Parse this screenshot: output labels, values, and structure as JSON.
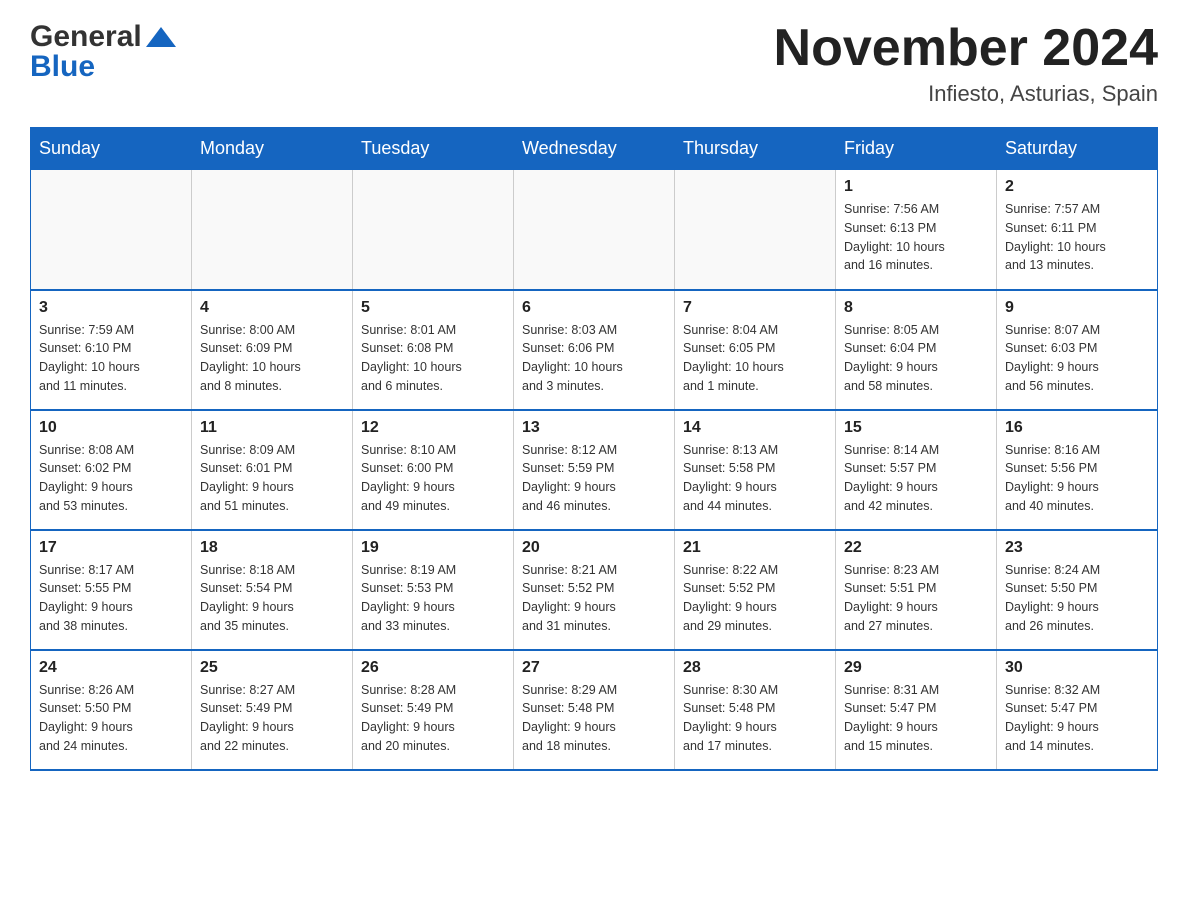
{
  "logo": {
    "line1": "General",
    "line2": "Blue"
  },
  "title": "November 2024",
  "location": "Infiesto, Asturias, Spain",
  "weekdays": [
    "Sunday",
    "Monday",
    "Tuesday",
    "Wednesday",
    "Thursday",
    "Friday",
    "Saturday"
  ],
  "weeks": [
    [
      {
        "day": "",
        "info": ""
      },
      {
        "day": "",
        "info": ""
      },
      {
        "day": "",
        "info": ""
      },
      {
        "day": "",
        "info": ""
      },
      {
        "day": "",
        "info": ""
      },
      {
        "day": "1",
        "info": "Sunrise: 7:56 AM\nSunset: 6:13 PM\nDaylight: 10 hours\nand 16 minutes."
      },
      {
        "day": "2",
        "info": "Sunrise: 7:57 AM\nSunset: 6:11 PM\nDaylight: 10 hours\nand 13 minutes."
      }
    ],
    [
      {
        "day": "3",
        "info": "Sunrise: 7:59 AM\nSunset: 6:10 PM\nDaylight: 10 hours\nand 11 minutes."
      },
      {
        "day": "4",
        "info": "Sunrise: 8:00 AM\nSunset: 6:09 PM\nDaylight: 10 hours\nand 8 minutes."
      },
      {
        "day": "5",
        "info": "Sunrise: 8:01 AM\nSunset: 6:08 PM\nDaylight: 10 hours\nand 6 minutes."
      },
      {
        "day": "6",
        "info": "Sunrise: 8:03 AM\nSunset: 6:06 PM\nDaylight: 10 hours\nand 3 minutes."
      },
      {
        "day": "7",
        "info": "Sunrise: 8:04 AM\nSunset: 6:05 PM\nDaylight: 10 hours\nand 1 minute."
      },
      {
        "day": "8",
        "info": "Sunrise: 8:05 AM\nSunset: 6:04 PM\nDaylight: 9 hours\nand 58 minutes."
      },
      {
        "day": "9",
        "info": "Sunrise: 8:07 AM\nSunset: 6:03 PM\nDaylight: 9 hours\nand 56 minutes."
      }
    ],
    [
      {
        "day": "10",
        "info": "Sunrise: 8:08 AM\nSunset: 6:02 PM\nDaylight: 9 hours\nand 53 minutes."
      },
      {
        "day": "11",
        "info": "Sunrise: 8:09 AM\nSunset: 6:01 PM\nDaylight: 9 hours\nand 51 minutes."
      },
      {
        "day": "12",
        "info": "Sunrise: 8:10 AM\nSunset: 6:00 PM\nDaylight: 9 hours\nand 49 minutes."
      },
      {
        "day": "13",
        "info": "Sunrise: 8:12 AM\nSunset: 5:59 PM\nDaylight: 9 hours\nand 46 minutes."
      },
      {
        "day": "14",
        "info": "Sunrise: 8:13 AM\nSunset: 5:58 PM\nDaylight: 9 hours\nand 44 minutes."
      },
      {
        "day": "15",
        "info": "Sunrise: 8:14 AM\nSunset: 5:57 PM\nDaylight: 9 hours\nand 42 minutes."
      },
      {
        "day": "16",
        "info": "Sunrise: 8:16 AM\nSunset: 5:56 PM\nDaylight: 9 hours\nand 40 minutes."
      }
    ],
    [
      {
        "day": "17",
        "info": "Sunrise: 8:17 AM\nSunset: 5:55 PM\nDaylight: 9 hours\nand 38 minutes."
      },
      {
        "day": "18",
        "info": "Sunrise: 8:18 AM\nSunset: 5:54 PM\nDaylight: 9 hours\nand 35 minutes."
      },
      {
        "day": "19",
        "info": "Sunrise: 8:19 AM\nSunset: 5:53 PM\nDaylight: 9 hours\nand 33 minutes."
      },
      {
        "day": "20",
        "info": "Sunrise: 8:21 AM\nSunset: 5:52 PM\nDaylight: 9 hours\nand 31 minutes."
      },
      {
        "day": "21",
        "info": "Sunrise: 8:22 AM\nSunset: 5:52 PM\nDaylight: 9 hours\nand 29 minutes."
      },
      {
        "day": "22",
        "info": "Sunrise: 8:23 AM\nSunset: 5:51 PM\nDaylight: 9 hours\nand 27 minutes."
      },
      {
        "day": "23",
        "info": "Sunrise: 8:24 AM\nSunset: 5:50 PM\nDaylight: 9 hours\nand 26 minutes."
      }
    ],
    [
      {
        "day": "24",
        "info": "Sunrise: 8:26 AM\nSunset: 5:50 PM\nDaylight: 9 hours\nand 24 minutes."
      },
      {
        "day": "25",
        "info": "Sunrise: 8:27 AM\nSunset: 5:49 PM\nDaylight: 9 hours\nand 22 minutes."
      },
      {
        "day": "26",
        "info": "Sunrise: 8:28 AM\nSunset: 5:49 PM\nDaylight: 9 hours\nand 20 minutes."
      },
      {
        "day": "27",
        "info": "Sunrise: 8:29 AM\nSunset: 5:48 PM\nDaylight: 9 hours\nand 18 minutes."
      },
      {
        "day": "28",
        "info": "Sunrise: 8:30 AM\nSunset: 5:48 PM\nDaylight: 9 hours\nand 17 minutes."
      },
      {
        "day": "29",
        "info": "Sunrise: 8:31 AM\nSunset: 5:47 PM\nDaylight: 9 hours\nand 15 minutes."
      },
      {
        "day": "30",
        "info": "Sunrise: 8:32 AM\nSunset: 5:47 PM\nDaylight: 9 hours\nand 14 minutes."
      }
    ]
  ]
}
